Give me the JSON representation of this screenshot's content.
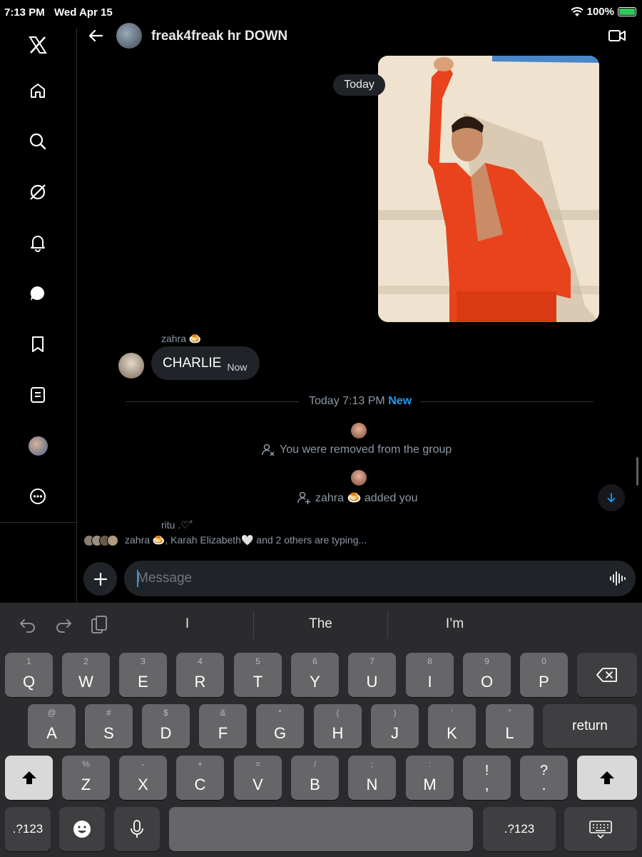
{
  "status_bar": {
    "time": "7:13 PM",
    "date": "Wed Apr 15",
    "battery": "100%"
  },
  "sidebar": {
    "items": [
      {
        "icon": "x-logo-icon"
      },
      {
        "icon": "home-icon"
      },
      {
        "icon": "search-icon"
      },
      {
        "icon": "grok-icon"
      },
      {
        "icon": "notifications-icon"
      },
      {
        "icon": "messages-icon"
      },
      {
        "icon": "bookmarks-icon"
      },
      {
        "icon": "lists-icon"
      },
      {
        "icon": "profile-avatar"
      },
      {
        "icon": "more-icon"
      }
    ]
  },
  "header": {
    "title": "freak4freak hr DOWN"
  },
  "conversation": {
    "date_pill": "Today",
    "message": {
      "sender": "zahra 🍮",
      "text": "CHARLIE",
      "time": "Now"
    },
    "new_divider": {
      "text": "Today 7:13 PM",
      "badge": "New"
    },
    "events": [
      {
        "text": "You were removed from the group",
        "icon": "person-removed-icon"
      },
      {
        "text": "zahra 🍮 added you",
        "icon": "person-add-icon"
      }
    ],
    "typing_name": "ritu .♡˚",
    "typing_text": "zahra 🍮, Karah Elizabeth🤍 and 2 others are typing..."
  },
  "composer": {
    "placeholder": "Message"
  },
  "keyboard": {
    "suggestions": [
      "I",
      "The",
      "I’m"
    ],
    "row1": [
      {
        "alt": "1",
        "main": "Q"
      },
      {
        "alt": "2",
        "main": "W"
      },
      {
        "alt": "3",
        "main": "E"
      },
      {
        "alt": "4",
        "main": "R"
      },
      {
        "alt": "5",
        "main": "T"
      },
      {
        "alt": "6",
        "main": "Y"
      },
      {
        "alt": "7",
        "main": "U"
      },
      {
        "alt": "8",
        "main": "I"
      },
      {
        "alt": "9",
        "main": "O"
      },
      {
        "alt": "0",
        "main": "P"
      }
    ],
    "row2": [
      {
        "alt": "@",
        "main": "A"
      },
      {
        "alt": "#",
        "main": "S"
      },
      {
        "alt": "$",
        "main": "D"
      },
      {
        "alt": "&",
        "main": "F"
      },
      {
        "alt": "*",
        "main": "G"
      },
      {
        "alt": "(",
        "main": "H"
      },
      {
        "alt": ")",
        "main": "J"
      },
      {
        "alt": "’",
        "main": "K"
      },
      {
        "alt": "”",
        "main": "L"
      }
    ],
    "row3": [
      {
        "alt": "%",
        "main": "Z"
      },
      {
        "alt": "-",
        "main": "X"
      },
      {
        "alt": "+",
        "main": "C"
      },
      {
        "alt": "=",
        "main": "V"
      },
      {
        "alt": "/",
        "main": "B"
      },
      {
        "alt": ";",
        "main": "N"
      },
      {
        "alt": ":",
        "main": "M"
      },
      {
        "alt": "!",
        "main": ","
      },
      {
        "alt": "?",
        "main": "."
      }
    ],
    "return_label": "return",
    "numbers_label": ".?123"
  }
}
